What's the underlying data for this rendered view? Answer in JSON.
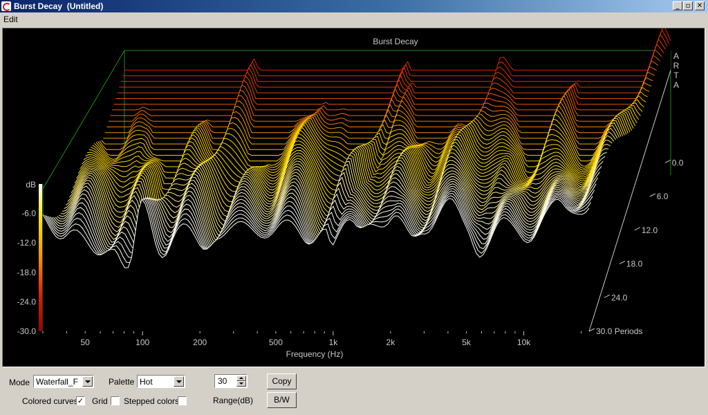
{
  "window": {
    "title": "Burst Decay  (Untitled)",
    "buttons": [
      "_",
      "▫",
      "✕"
    ]
  },
  "menu": {
    "items": [
      "Edit"
    ]
  },
  "chart_data": {
    "type": "waterfall",
    "title": "Burst Decay",
    "watermark": "ARTA",
    "xlabel": "Frequency (Hz)",
    "x_scale": "log",
    "xlim": [
      30,
      22000
    ],
    "x_tick_labels": [
      "50",
      "100",
      "200",
      "500",
      "1k",
      "2k",
      "5k",
      "10k"
    ],
    "x_ticks": [
      50,
      100,
      200,
      500,
      1000,
      2000,
      5000,
      10000
    ],
    "zlabel": "dB",
    "zlim": [
      -30,
      0
    ],
    "z_tick_labels": [
      "dB",
      "-6.0",
      "-12.0",
      "-18.0",
      "-24.0",
      "-30.0"
    ],
    "z_ticks": [
      0,
      -6,
      -12,
      -18,
      -24,
      -30
    ],
    "depth_label": "Periods",
    "depth_tick_labels": [
      "0.0",
      "6.0",
      "12.0",
      "18.0",
      "24.0",
      "30.0 Periods"
    ],
    "depth_ticks": [
      0,
      6,
      12,
      18,
      24,
      30
    ],
    "depth_range": [
      0,
      30
    ],
    "palette": "Hot",
    "colors": {
      "background": "#000000",
      "frame": "#1e8c1e",
      "text": "#c8c8c8",
      "hot_high": "#ffffff",
      "hot_mid": "#ffd200",
      "hot_low": "#c80000"
    },
    "front_profile": {
      "freq": [
        40,
        55,
        70,
        85,
        100,
        125,
        150,
        200,
        250,
        350,
        500,
        700,
        900,
        1000,
        1300,
        1600,
        2000,
        2500,
        3000,
        4000,
        5000,
        6000,
        8000,
        10000,
        13000,
        16000,
        20000
      ],
      "level_db": [
        -8,
        -16,
        -10,
        -18,
        -6,
        -12,
        -9,
        -14,
        -8,
        -11,
        -7,
        -13,
        -6,
        -12,
        -10,
        -5,
        -9,
        -11,
        -7,
        -6,
        -8,
        -12,
        -10,
        -9,
        -7,
        -6,
        -3
      ]
    }
  },
  "controls": {
    "mode_label": "Mode",
    "mode_value": "Waterfall_F",
    "palette_label": "Palette",
    "palette_value": "Hot",
    "range_value": "30",
    "range_label": "Range(dB)",
    "copy_label": "Copy",
    "bw_label": "B/W",
    "colored_curves_label": "Colored curves",
    "colored_curves_checked": true,
    "grid_label": "Grid",
    "grid_checked": false,
    "stepped_colors_label": "Stepped colors",
    "stepped_colors_checked": false
  }
}
